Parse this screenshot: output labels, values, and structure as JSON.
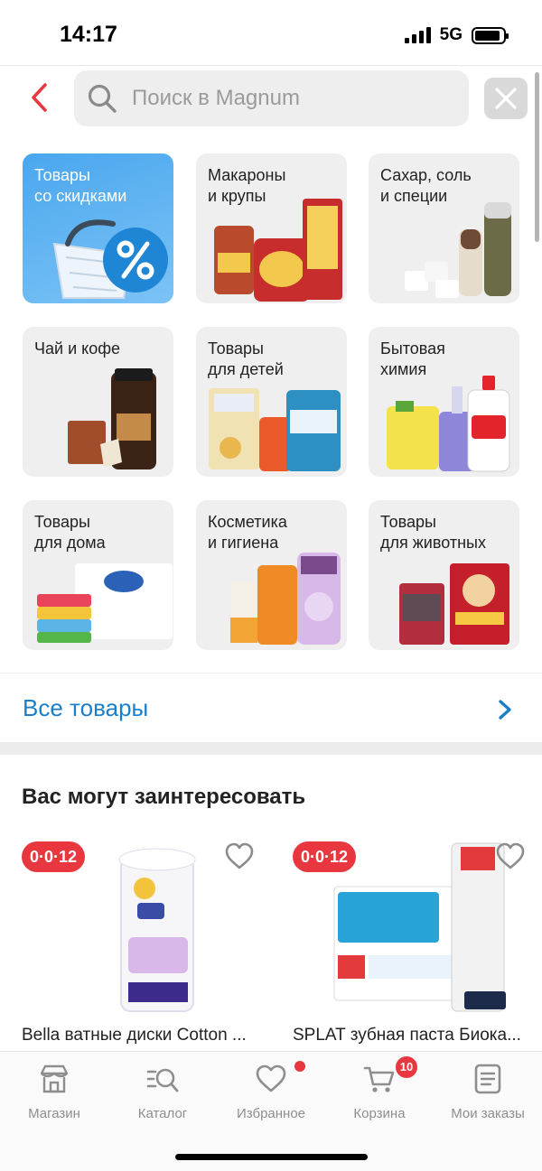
{
  "status_bar": {
    "time": "14:17",
    "network": "5G",
    "battery_level": 0.9
  },
  "search": {
    "placeholder": "Поиск в Magnum"
  },
  "categories": [
    {
      "label": "Товары\nсо скидками"
    },
    {
      "label": "Макароны\nи крупы"
    },
    {
      "label": "Сахар, соль\nи специи"
    },
    {
      "label": "Чай и кофе"
    },
    {
      "label": "Товары\nдля детей"
    },
    {
      "label": "Бытовая\nхимия"
    },
    {
      "label": "Товары\nдля дома"
    },
    {
      "label": "Косметика\nи гигиена"
    },
    {
      "label": "Товары\nдля животных"
    }
  ],
  "all_goods": {
    "label": "Все товары"
  },
  "recommendations": {
    "title": "Вас могут заинтересовать",
    "products": [
      {
        "badge": "0·0·12",
        "name": "Bella ватные диски Cotton ..."
      },
      {
        "badge": "0·0·12",
        "name": "SPLAT зубная паста Биока..."
      }
    ]
  },
  "tabbar": {
    "items": [
      {
        "label": "Магазин",
        "icon": "store-icon"
      },
      {
        "label": "Каталог",
        "icon": "catalog-search-icon"
      },
      {
        "label": "Избранное",
        "icon": "heart-icon"
      },
      {
        "label": "Корзина",
        "icon": "cart-icon",
        "badge": "10"
      },
      {
        "label": "Мои заказы",
        "icon": "orders-icon"
      }
    ]
  },
  "colors": {
    "accent_red": "#e8373f",
    "link_blue": "#1a7fc9",
    "discount_tile": "#4aa7ee"
  }
}
